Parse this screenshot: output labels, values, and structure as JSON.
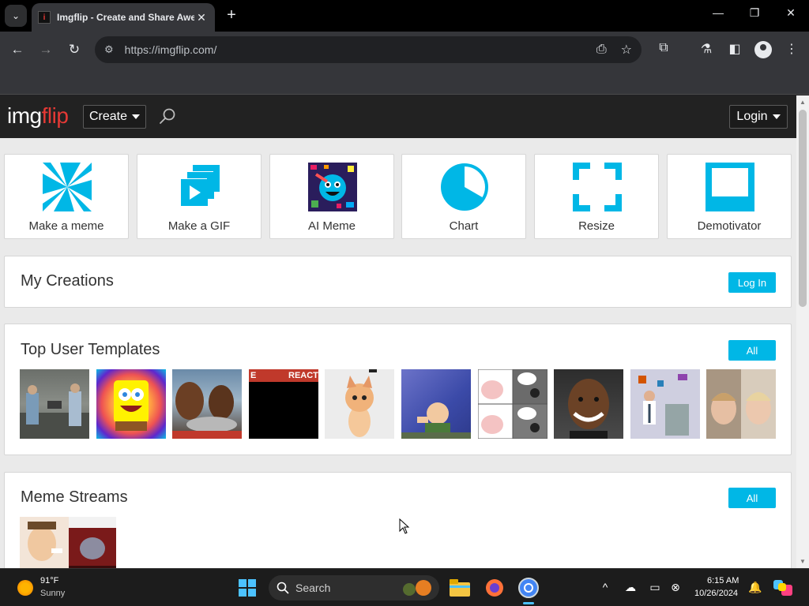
{
  "browser": {
    "tab_title": "Imgflip - Create and Share Awe",
    "url": "https://imgflip.com/",
    "new_tab": "+",
    "tab_close": "✕"
  },
  "site": {
    "logo_img": "img",
    "logo_flip": "flip",
    "create_label": "Create",
    "login_label": "Login",
    "colors": {
      "accent": "#00b7e6",
      "header_bg": "#222222",
      "logo_red": "#e53935"
    }
  },
  "tools": [
    {
      "label": "Make a meme",
      "icon": "pinwheel-icon"
    },
    {
      "label": "Make a GIF",
      "icon": "gif-stack-icon"
    },
    {
      "label": "AI Meme",
      "icon": "ai-meme-icon"
    },
    {
      "label": "Chart",
      "icon": "pie-chart-icon"
    },
    {
      "label": "Resize",
      "icon": "resize-corners-icon"
    },
    {
      "label": "Demotivator",
      "icon": "demotivator-frame-icon"
    }
  ],
  "my_creations": {
    "title": "My Creations",
    "button": "Log In"
  },
  "top_templates": {
    "title": "Top User Templates",
    "button": "All",
    "items": [
      "Template 1",
      "Template 2",
      "Template 3",
      "Template 4",
      "Template 5",
      "Template 6",
      "Template 7",
      "Template 8",
      "Template 9",
      "Template 10"
    ],
    "reaction_text": "REACTI",
    "reaction_prefix": "E"
  },
  "meme_streams": {
    "title": "Meme Streams",
    "button": "All"
  },
  "taskbar": {
    "temp": "91°F",
    "condition": "Sunny",
    "search_placeholder": "Search",
    "time": "6:15 AM",
    "date": "10/26/2024"
  }
}
